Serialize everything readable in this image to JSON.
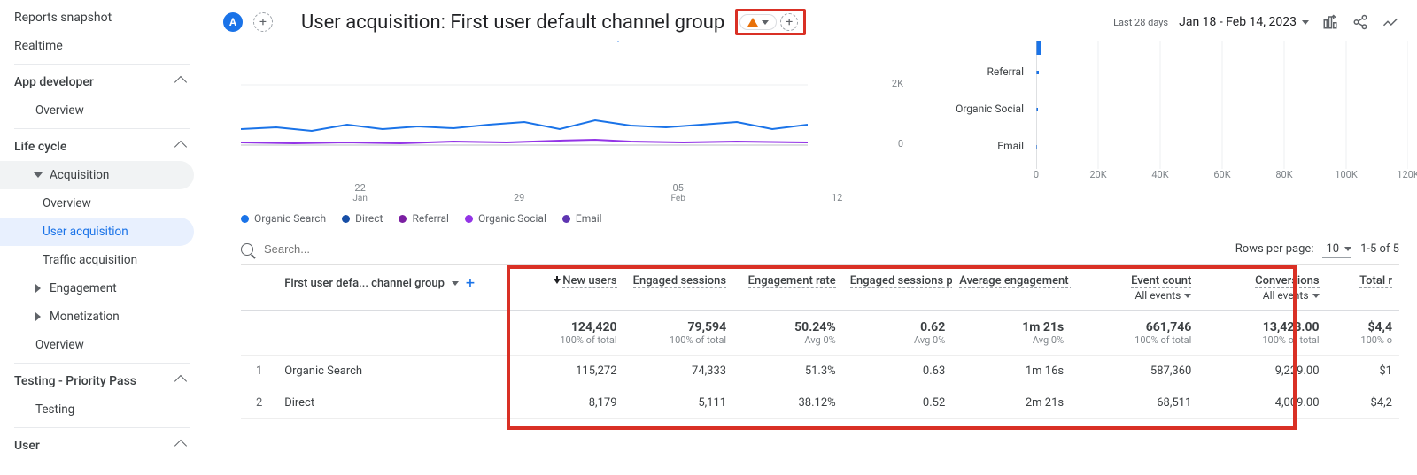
{
  "sidebar": {
    "reports_snapshot": "Reports snapshot",
    "realtime": "Realtime",
    "app_dev": "App developer",
    "app_dev_overview": "Overview",
    "life_cycle": "Life cycle",
    "acquisition": "Acquisition",
    "acq_overview": "Overview",
    "user_acq": "User acquisition",
    "traffic_acq": "Traffic acquisition",
    "engagement": "Engagement",
    "monetization": "Monetization",
    "mon_overview": "Overview",
    "testing_pp": "Testing - Priority Pass",
    "testing": "Testing",
    "user": "User"
  },
  "header": {
    "badge": "A",
    "title": "User acquisition: First user default channel group",
    "date_prefix": "Last 28 days",
    "date_range": "Jan 18 - Feb 14, 2023"
  },
  "chart_data": [
    {
      "type": "line",
      "ylim": [
        0,
        2000
      ],
      "y_ticks": [
        "0",
        "2K"
      ],
      "x_ticks": [
        {
          "label": "22",
          "sub": "Jan",
          "pos": 0.18
        },
        {
          "label": "29",
          "sub": "",
          "pos": 0.42
        },
        {
          "label": "05",
          "sub": "Feb",
          "pos": 0.66
        },
        {
          "label": "12",
          "sub": "",
          "pos": 0.9
        }
      ],
      "legend": [
        {
          "name": "Organic Search",
          "color": "#1a73e8"
        },
        {
          "name": "Direct",
          "color": "#174ea6"
        },
        {
          "name": "Referral",
          "color": "#7b1fa2"
        },
        {
          "name": "Organic Social",
          "color": "#9334e6"
        },
        {
          "name": "Email",
          "color": "#5e35b1"
        }
      ]
    },
    {
      "type": "bar",
      "xlim": [
        0,
        120000
      ],
      "x_ticks": [
        {
          "label": "0",
          "pos": 0
        },
        {
          "label": "20K",
          "pos": 0.167
        },
        {
          "label": "40K",
          "pos": 0.333
        },
        {
          "label": "60K",
          "pos": 0.5
        },
        {
          "label": "80K",
          "pos": 0.667
        },
        {
          "label": "100K",
          "pos": 0.833
        },
        {
          "label": "120K",
          "pos": 1.0
        }
      ],
      "categories": [
        "Referral",
        "Organic Social",
        "Email"
      ],
      "values": [
        500,
        350,
        200
      ],
      "color": "#1a73e8",
      "top_bar_partial": true
    }
  ],
  "search": {
    "placeholder": "Search..."
  },
  "table_controls": {
    "rpp_label": "Rows per page:",
    "rpp_value": "10",
    "range": "1-5 of 5"
  },
  "table": {
    "dimension_label": "First user defa... channel group",
    "columns": [
      {
        "label": "New users",
        "sort": true
      },
      {
        "label": "Engaged sessions"
      },
      {
        "label": "Engagement rate"
      },
      {
        "label": "Engaged sessions per user"
      },
      {
        "label": "Average engagement time"
      },
      {
        "label": "Event count",
        "selector": "All events"
      },
      {
        "label": "Conversions",
        "selector": "All events"
      },
      {
        "label": "Total r"
      }
    ],
    "totals": {
      "v": [
        "124,420",
        "79,594",
        "50.24%",
        "0.62",
        "1m 21s",
        "661,746",
        "13,428.00",
        "$4,4"
      ],
      "s": [
        "100% of total",
        "100% of total",
        "Avg 0%",
        "Avg 0%",
        "Avg 0%",
        "100% of total",
        "100% of total",
        "100% o"
      ]
    },
    "rows": [
      {
        "idx": "1",
        "dim": "Organic Search",
        "v": [
          "115,272",
          "74,333",
          "51.3%",
          "0.63",
          "1m 16s",
          "587,360",
          "9,229.00",
          "$1"
        ]
      },
      {
        "idx": "2",
        "dim": "Direct",
        "v": [
          "8,179",
          "5,111",
          "38.12%",
          "0.52",
          "2m 21s",
          "68,511",
          "4,009.00",
          "$4,2"
        ]
      }
    ]
  }
}
